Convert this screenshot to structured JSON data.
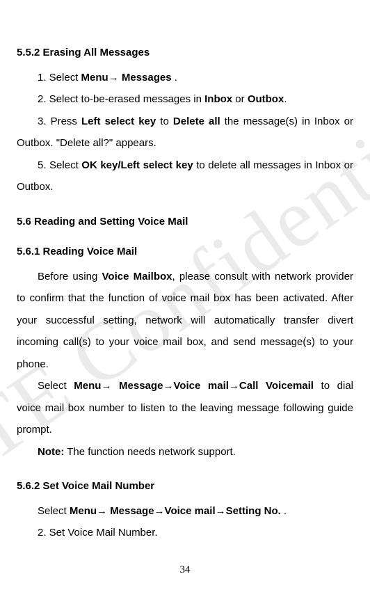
{
  "watermark": "ZTE Confidential",
  "sections": {
    "s552": {
      "title": "5.5.2 Erasing All Messages",
      "p1_pre": "1. Select ",
      "p1_b1": "Menu→ Messages",
      "p1_post": " .",
      "p2_pre": "2. Select to-be-erased messages in ",
      "p2_b1": "Inbox",
      "p2_mid": " or ",
      "p2_b2": "Outbox",
      "p2_post": ".",
      "p3_pre": "3. Press ",
      "p3_b1": "Left select key",
      "p3_mid": " to ",
      "p3_b2": "Delete all",
      "p3_post": " the message(s) in Inbox or Outbox. \"Delete all?\" appears.",
      "p4_pre": "5. Select ",
      "p4_b1": "OK key/Left select key",
      "p4_post": " to delete all messages in Inbox or Outbox."
    },
    "s56": {
      "title": "5.6  Reading and Setting Voice Mail"
    },
    "s561": {
      "title": "5.6.1 Reading Voice Mail",
      "p1_pre": "Before using ",
      "p1_b1": "Voice Mailbox",
      "p1_post": ", please consult with network provider to confirm that the function of voice mail box has been activated. After your successful setting, network will automatically transfer divert incoming call(s) to your voice mail box, and send message(s) to your phone.",
      "p2_pre": "Select ",
      "p2_b1": "Menu→ Message→Voice mail→Call Voicemail",
      "p2_post": " to dial voice mail box number to listen to the leaving message following guide prompt.",
      "p3_b1": "Note:",
      "p3_post": " The function needs network support."
    },
    "s562": {
      "title": "5.6.2 Set Voice Mail Number",
      "p1_pre": "Select ",
      "p1_b1": "Menu→ Message→Voice mail→Setting No.",
      "p1_post": " .",
      "p2": "2. Set Voice Mail Number."
    }
  },
  "pageNumber": "34"
}
